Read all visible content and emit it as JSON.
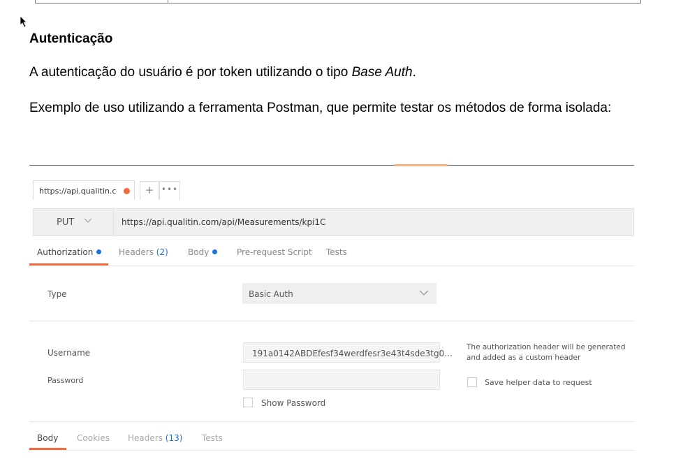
{
  "document": {
    "heading": "Autenticação",
    "para1_prefix": "A autenticação do usuário é por token utilizando o tipo ",
    "para1_italic": "Base Auth",
    "para1_suffix": ".",
    "para2": "Exemplo de uso utilizando a ferramenta Postman, que permite testar os métodos de forma isolada:"
  },
  "postman": {
    "tab_label": "https://api.qualitin.com",
    "tab_add": "+",
    "tab_more": "•••",
    "method": "PUT",
    "url": "https://api.qualitin.com/api/Measurements/kpi1C",
    "request_tabs": {
      "authorization": "Authorization",
      "headers": "Headers",
      "headers_count": "(2)",
      "body": "Body",
      "prerequest": "Pre-request Script",
      "tests": "Tests"
    },
    "auth": {
      "type_label": "Type",
      "type_value": "Basic Auth",
      "username_label": "Username",
      "username_value": "191a0142ABDEfesf34werdfesr3e43t4sde3tg0...",
      "password_label": "Password",
      "password_value": "",
      "show_password": "Show Password",
      "note": "The authorization header will be generated and added as a custom header",
      "save_helper": "Save helper data to request"
    },
    "response_tabs": {
      "body": "Body",
      "cookies": "Cookies",
      "headers": "Headers",
      "headers_count": "(13)",
      "tests": "Tests"
    }
  },
  "colors": {
    "accent": "#f26b3a",
    "link_blue": "#1a73d9"
  }
}
